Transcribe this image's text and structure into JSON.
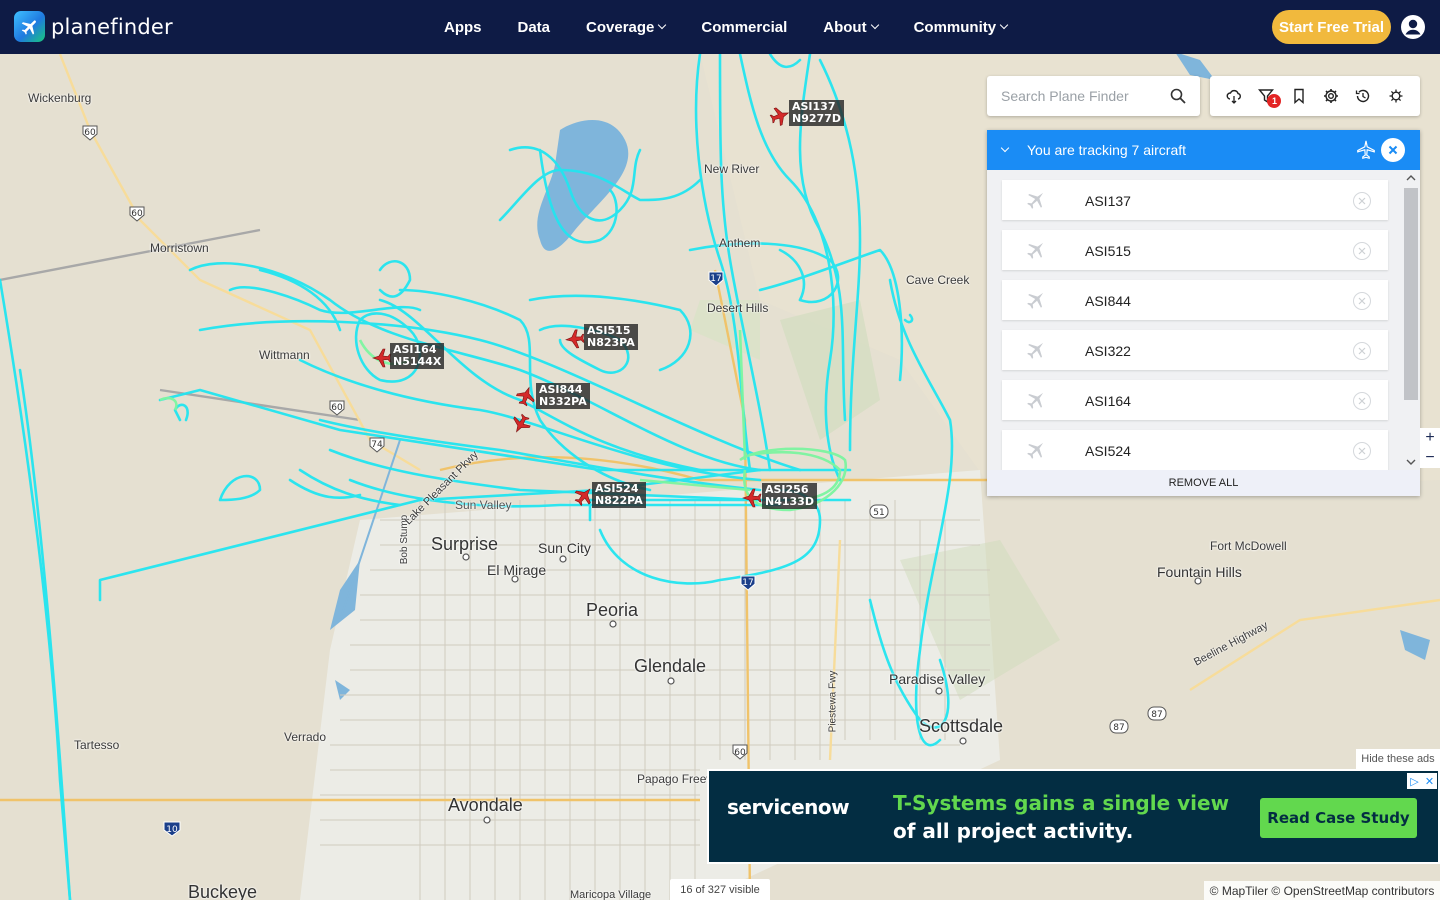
{
  "header": {
    "brand": "planefinder",
    "nav": [
      {
        "label": "Apps",
        "dropdown": false
      },
      {
        "label": "Data",
        "dropdown": false
      },
      {
        "label": "Coverage",
        "dropdown": true
      },
      {
        "label": "Commercial",
        "dropdown": false
      },
      {
        "label": "About",
        "dropdown": true
      },
      {
        "label": "Community",
        "dropdown": true
      }
    ],
    "cta": "Start Free Trial",
    "user_icon": "user-circle-icon",
    "colors": {
      "bar": "#0e1b45",
      "cta": "#f1b93d"
    }
  },
  "search": {
    "placeholder": "Search Plane Finder",
    "value": ""
  },
  "toolbar": {
    "icons": [
      "weather-cloud-icon",
      "filter-icon",
      "bookmark-icon",
      "settings-icon",
      "history-icon",
      "virus-icon"
    ],
    "filter_badge": "1"
  },
  "tracking": {
    "title": "You are tracking 7 aircraft",
    "aircraft": [
      "ASI137",
      "ASI515",
      "ASI844",
      "ASI322",
      "ASI164",
      "ASI524"
    ],
    "remove_all": "REMOVE ALL",
    "color": "#1a8cf5"
  },
  "map": {
    "places": [
      {
        "name": "Wickenburg",
        "size": "small"
      },
      {
        "name": "Morristown",
        "size": "small"
      },
      {
        "name": "Wittmann",
        "size": "small"
      },
      {
        "name": "New River",
        "size": "small"
      },
      {
        "name": "Anthem",
        "size": "small"
      },
      {
        "name": "Cave Creek",
        "size": "small"
      },
      {
        "name": "Desert Hills",
        "size": "small"
      },
      {
        "name": "Surprise",
        "size": "big"
      },
      {
        "name": "Sun City",
        "size": "mid"
      },
      {
        "name": "El Mirage",
        "size": "mid"
      },
      {
        "name": "Peoria",
        "size": "big"
      },
      {
        "name": "Glendale",
        "size": "big"
      },
      {
        "name": "Fort McDowell",
        "size": "small"
      },
      {
        "name": "Fountain Hills",
        "size": "mid"
      },
      {
        "name": "Paradise Valley",
        "size": "mid"
      },
      {
        "name": "Scottsdale",
        "size": "big"
      },
      {
        "name": "Tartesso",
        "size": "small"
      },
      {
        "name": "Verrado",
        "size": "small"
      },
      {
        "name": "Avondale",
        "size": "big"
      },
      {
        "name": "Buckeye",
        "size": "big"
      },
      {
        "name": "Papago Freew",
        "size": "small"
      },
      {
        "name": "Maricopa Village",
        "size": "small"
      },
      {
        "name": "Beeline Highway",
        "size": "small"
      },
      {
        "name": "Piestewa Fwy",
        "size": "small"
      },
      {
        "name": "Bob Stump",
        "size": "small"
      },
      {
        "name": "Sun Valley",
        "size": "small"
      },
      {
        "name": "Lake Pleasant Pkwy",
        "size": "small"
      }
    ],
    "route_shields": [
      "60",
      "60",
      "60",
      "74",
      "17",
      "17",
      "51",
      "87",
      "87",
      "10",
      "60"
    ],
    "aircraft_tags": [
      {
        "callsign": "ASI137",
        "reg": "N9277D"
      },
      {
        "callsign": "ASI515",
        "reg": "N823PA"
      },
      {
        "callsign": "ASI164",
        "reg": "N5144X"
      },
      {
        "callsign": "ASI844",
        "reg": "N332PA"
      },
      {
        "callsign": "ASI524",
        "reg": "N822PA"
      },
      {
        "callsign": "ASI256",
        "reg": "N4133D"
      }
    ],
    "zoom_in": "+",
    "zoom_out": "−",
    "visible_count": "16 of 327 visible",
    "attribution": "© MapTiler © OpenStreetMap contributors",
    "track_color": "#22e5f0",
    "track_color_low": "#7cf5a0"
  },
  "ad": {
    "hide_label": "Hide these ads",
    "brand": "servicenow",
    "headline": "T-Systems gains a single view",
    "subline": "of all project activity.",
    "cta": "Read Case Study"
  }
}
